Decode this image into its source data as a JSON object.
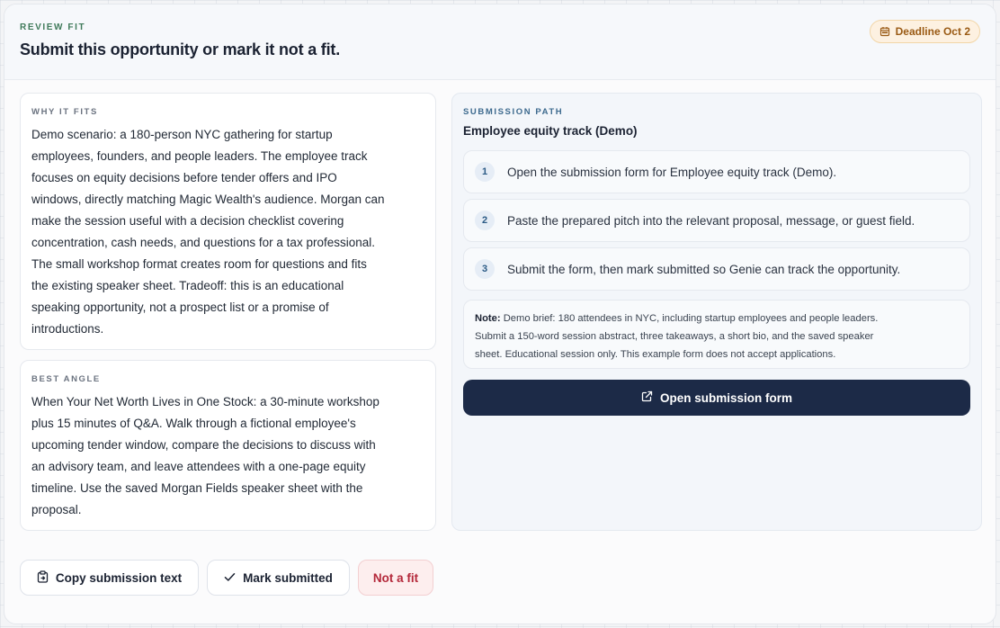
{
  "header": {
    "eyebrow": "REVIEW FIT",
    "title": "Submit this opportunity or mark it not a fit.",
    "deadline": "Deadline Oct 2"
  },
  "why_it_fits": {
    "eyebrow": "WHY IT FITS",
    "lines": [
      "Demo scenario: a 180-person NYC gathering for startup",
      "employees, founders, and people leaders. The employee track",
      "focuses on equity decisions before tender offers and IPO",
      "windows, directly matching Magic Wealth's audience. Morgan can",
      "make the session useful with a decision checklist covering",
      "concentration, cash needs, and questions for a tax professional.",
      "The small workshop format creates room for questions and fits",
      "the existing speaker sheet. Tradeoff: this is an educational",
      "speaking opportunity, not a prospect list or a promise of",
      "introductions."
    ]
  },
  "best_angle": {
    "eyebrow": "BEST ANGLE",
    "lines": [
      "When Your Net Worth Lives in One Stock: a 30-minute workshop",
      "plus 15 minutes of Q&A. Walk through a fictional employee's",
      "upcoming tender window, compare the decisions to discuss with",
      "an advisory team, and leave attendees with a one-page equity",
      "timeline. Use the saved Morgan Fields speaker sheet with the",
      "proposal."
    ]
  },
  "submission_path": {
    "eyebrow": "SUBMISSION PATH",
    "track": "Employee equity track (Demo)",
    "steps": [
      {
        "num": "1",
        "text": "Open the submission form for Employee equity track (Demo)."
      },
      {
        "num": "2",
        "text": "Paste the prepared pitch into the relevant proposal, message, or guest field."
      },
      {
        "num": "3",
        "text": "Submit the form, then mark submitted so Genie can track the opportunity."
      }
    ],
    "note_label": "Note:",
    "note_lines": [
      " Demo brief: 180 attendees in NYC, including startup employees and people leaders.",
      "Submit a 150-word session abstract, three takeaways, a short bio, and the saved speaker",
      "sheet. Educational session only. This example form does not accept applications."
    ],
    "open_button": "Open submission form"
  },
  "actions": {
    "copy": "Copy submission text",
    "mark": "Mark submitted",
    "not_fit": "Not a fit"
  },
  "colors": {
    "primary_button": "#1c2a47",
    "deadline_bg": "#fdf1e1",
    "deadline_text": "#9a5a14",
    "not_fit_bg": "#fdeeee",
    "not_fit_text": "#b4283a"
  },
  "icons": {
    "deadline": "calendar-icon",
    "open": "external-link-icon",
    "copy": "clipboard-icon",
    "mark": "checkmark-icon"
  }
}
